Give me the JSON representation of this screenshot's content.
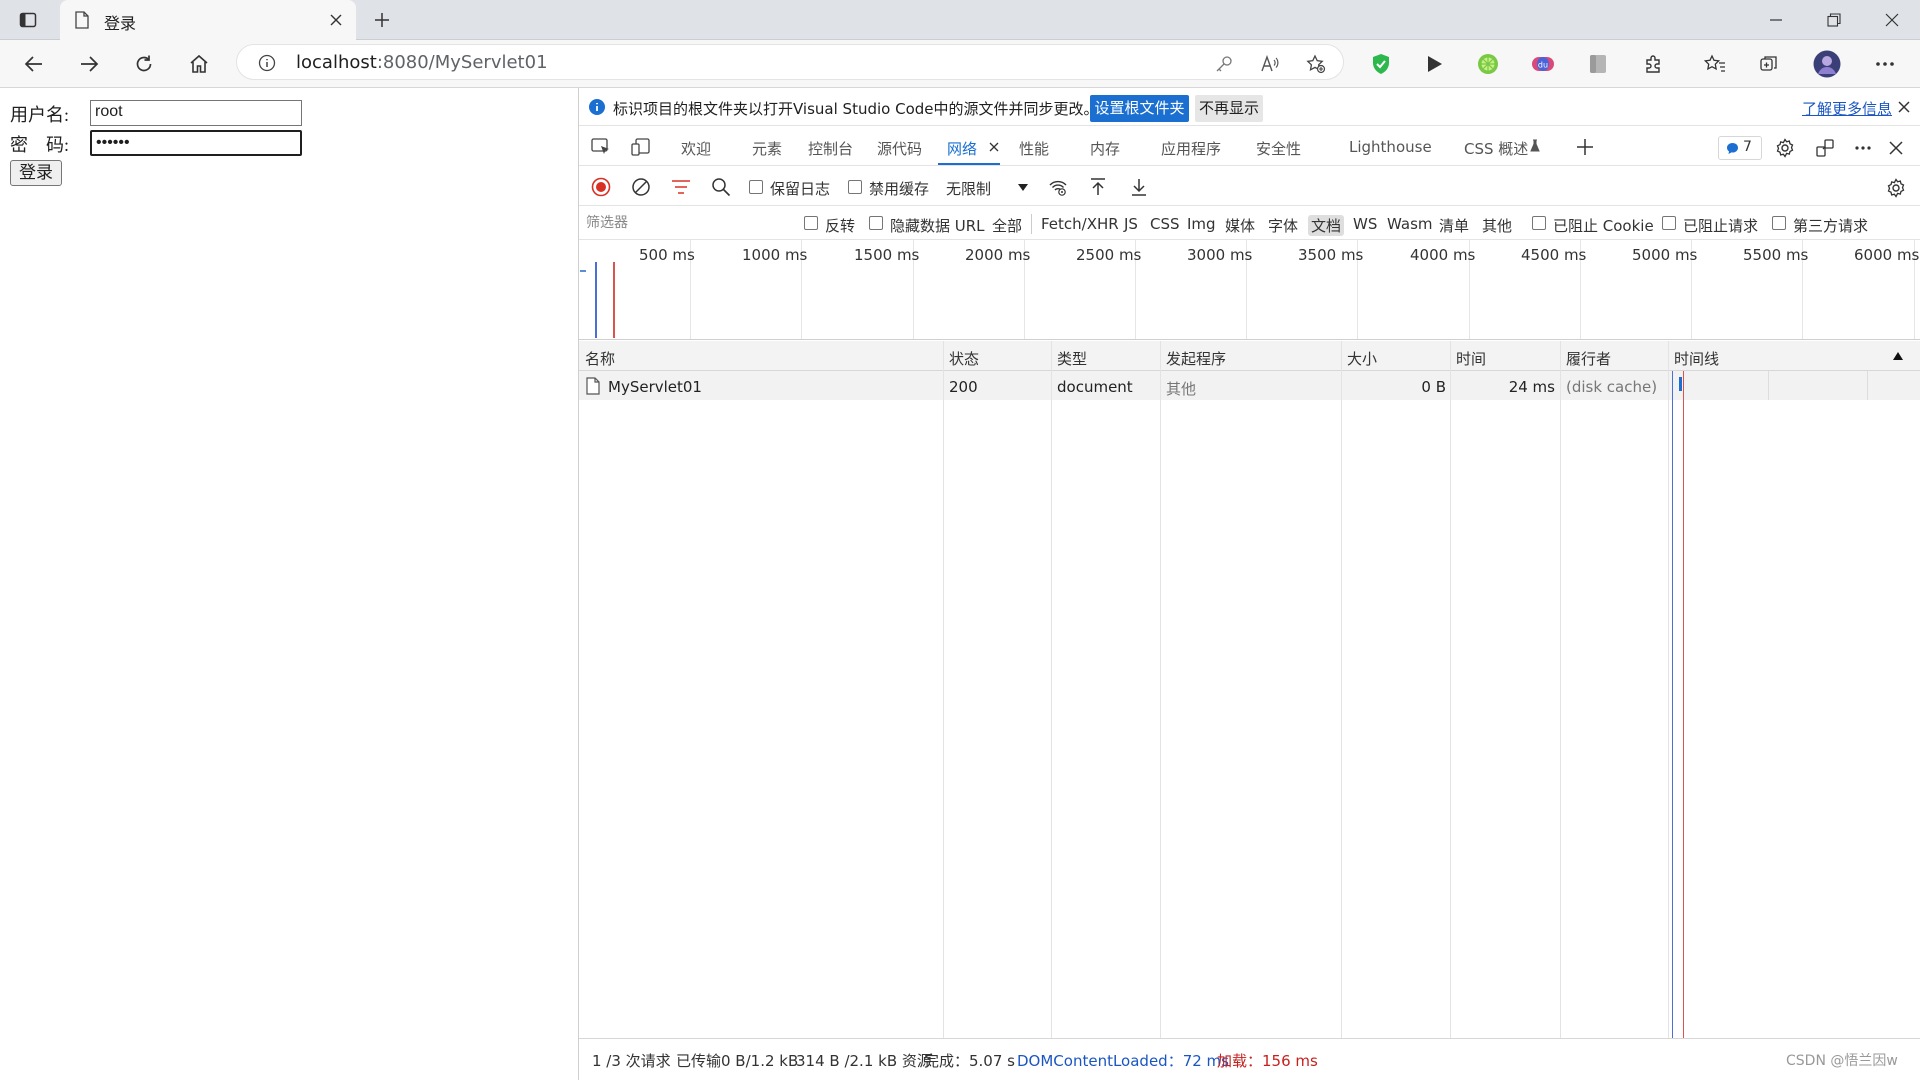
{
  "browser": {
    "tab_title": "登录",
    "url_host": "localhost",
    "url_path": ":8080/MyServlet01"
  },
  "page": {
    "username_label": "用户名:",
    "password_label": "密　码:",
    "username_value": "root",
    "password_value": "••••••",
    "login_button": "登录"
  },
  "devtools": {
    "infobar": {
      "message": "标识项目的根文件夹以打开Visual Studio Code中的源文件并同步更改。",
      "set_root_button": "设置根文件夹",
      "dont_show_button": "不再显示",
      "learn_more": "了解更多信息"
    },
    "tabs": [
      {
        "label": "欢迎"
      },
      {
        "label": "元素"
      },
      {
        "label": "控制台"
      },
      {
        "label": "源代码"
      },
      {
        "label": "网络"
      },
      {
        "label": "性能"
      },
      {
        "label": "内存"
      },
      {
        "label": "应用程序"
      },
      {
        "label": "安全性"
      },
      {
        "label": "Lighthouse"
      },
      {
        "label": "CSS 概述"
      }
    ],
    "issues_count": "7",
    "toolbar": {
      "preserve_log": "保留日志",
      "disable_cache": "禁用缓存",
      "throttling": "无限制"
    },
    "filter": {
      "placeholder": "筛选器",
      "invert": "反转",
      "hide_data_urls": "隐藏数据 URL",
      "types": [
        "全部",
        "Fetch/XHR",
        "JS",
        "CSS",
        "Img",
        "媒体",
        "字体",
        "文档",
        "WS",
        "Wasm",
        "清单",
        "其他"
      ],
      "blocked_cookies": "已阻止 Cookie",
      "blocked_requests": "已阻止请求",
      "third_party": "第三方请求"
    },
    "overview_ticks": [
      "500 ms",
      "1000 ms",
      "1500 ms",
      "2000 ms",
      "2500 ms",
      "3000 ms",
      "3500 ms",
      "4000 ms",
      "4500 ms",
      "5000 ms",
      "5500 ms",
      "6000 ms"
    ],
    "columns": [
      "名称",
      "状态",
      "类型",
      "发起程序",
      "大小",
      "时间",
      "履行者",
      "时间线"
    ],
    "rows": [
      {
        "name": "MyServlet01",
        "status": "200",
        "type": "document",
        "initiator": "其他",
        "size": "0 B",
        "time": "24 ms",
        "fulfilled_by": "(disk cache)"
      }
    ],
    "status_bar": {
      "requests": "1 /3 次请求",
      "transferred": "已传输0 B/1.2 kB",
      "resources": "314 B /2.1 kB 资源",
      "finish": "完成：5.07 s",
      "dom_loaded": "DOMContentLoaded：72 ms",
      "load": "加载：156 ms"
    }
  },
  "watermark": "CSDN @悟兰因w",
  "colors": {
    "accent": "#1a6fd1",
    "record_red": "#d93025",
    "dom_blue": "#1a56c2",
    "load_red": "#c5221f"
  }
}
